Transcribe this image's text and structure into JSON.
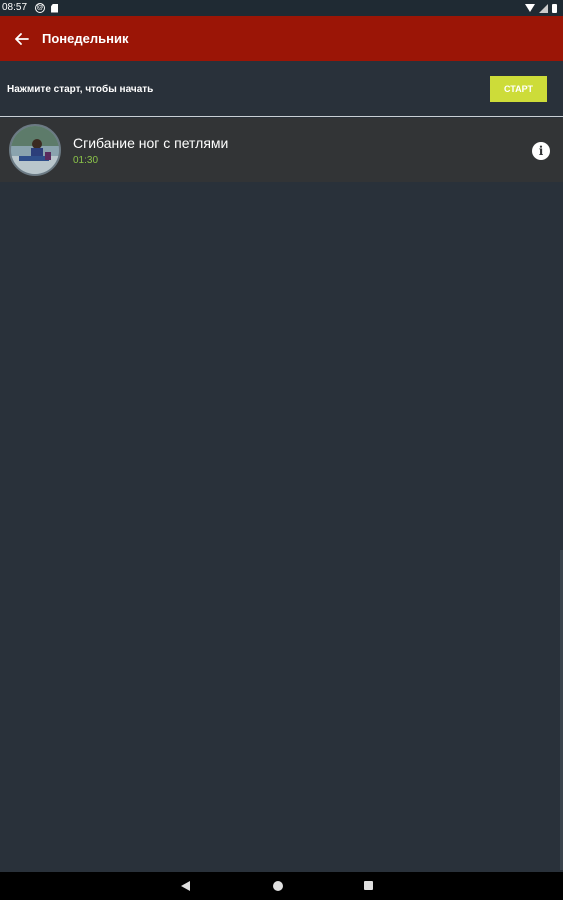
{
  "status_bar": {
    "time": "08:57",
    "left_icons": [
      "at-sign-icon",
      "sd-card-icon"
    ],
    "right_icons": [
      "wifi-icon",
      "signal-icon",
      "battery-icon"
    ]
  },
  "app_bar": {
    "title": "Понедельник",
    "back_icon": "arrow-left-icon",
    "color": "#9b1506"
  },
  "start_row": {
    "hint": "Нажмите старт, чтобы начать",
    "start_label": "СТАРТ",
    "button_color": "#cddc39"
  },
  "exercises": [
    {
      "name": "Сгибание ног с петлями",
      "duration": "01:30",
      "info_icon": "info-icon"
    }
  ],
  "colors": {
    "background": "#29313a",
    "row": "#323436",
    "duration": "#8bc34a"
  },
  "nav_bar": {
    "icons": [
      "nav-back-icon",
      "nav-home-icon",
      "nav-recents-icon"
    ]
  }
}
